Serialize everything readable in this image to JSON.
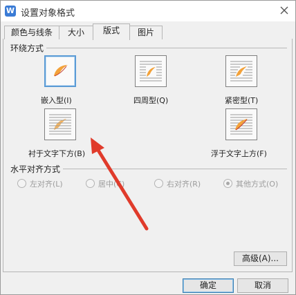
{
  "window": {
    "title": "设置对象格式",
    "app_logo": "W"
  },
  "tabs": [
    {
      "label": "颜色与线条"
    },
    {
      "label": "大小"
    },
    {
      "label": "版式"
    },
    {
      "label": "图片"
    }
  ],
  "active_tab": "版式",
  "wrap_section": {
    "heading": "环绕方式",
    "options": [
      {
        "label": "嵌入型(I)",
        "selected": true
      },
      {
        "label": "四周型(Q)",
        "selected": false
      },
      {
        "label": "紧密型(T)",
        "selected": false
      },
      {
        "label": "衬于文字下方(B)",
        "selected": false
      },
      {
        "label": "浮于文字上方(F)",
        "selected": false
      }
    ]
  },
  "align_section": {
    "heading": "水平对齐方式",
    "options": [
      {
        "label": "左对齐(L)",
        "checked": false
      },
      {
        "label": "居中(C)",
        "checked": false
      },
      {
        "label": "右对齐(R)",
        "checked": false
      },
      {
        "label": "其他方式(O)",
        "checked": true
      }
    ]
  },
  "buttons": {
    "advanced": "高级(A)...",
    "ok": "确定",
    "cancel": "取消"
  },
  "annotation_color": "#e03b2b",
  "accent_color": "#5b9bd5"
}
